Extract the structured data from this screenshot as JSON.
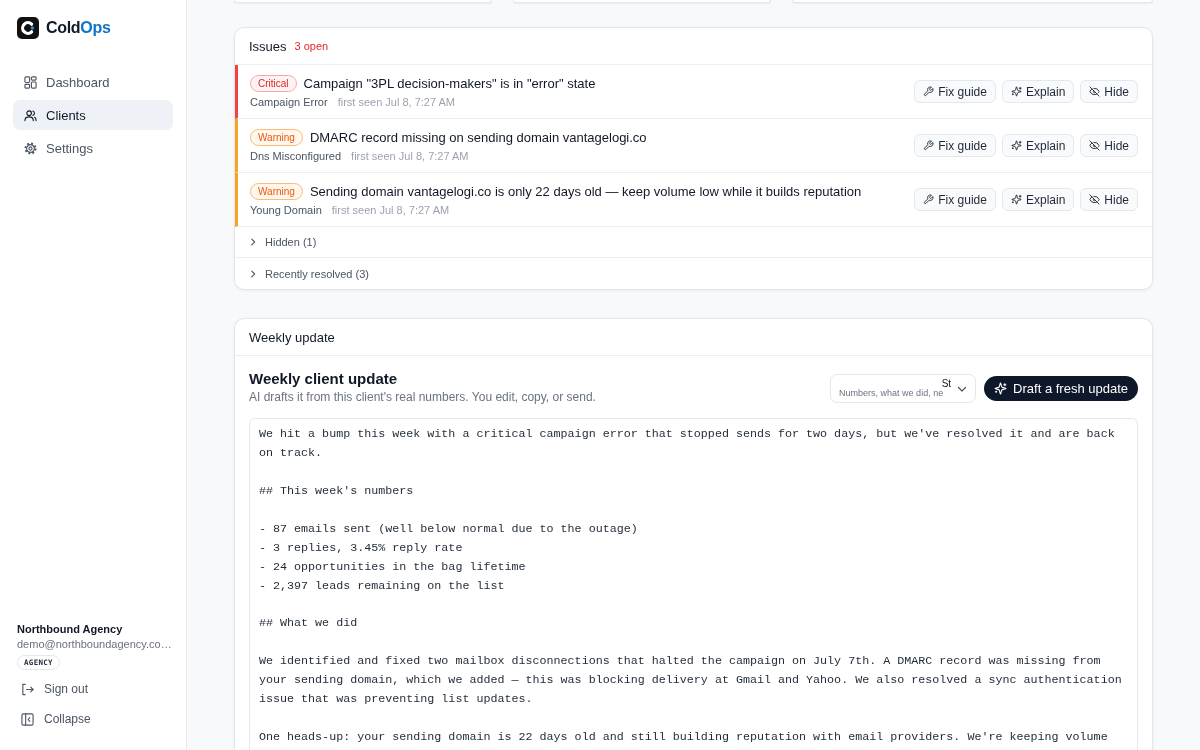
{
  "sidebar": {
    "brand": {
      "text": "Cold",
      "accent": "Ops"
    },
    "nav": [
      {
        "label": "Dashboard",
        "selected": false
      },
      {
        "label": "Clients",
        "selected": true
      },
      {
        "label": "Settings",
        "selected": false
      }
    ],
    "account": {
      "name": "Northbound Agency",
      "email": "demo@northboundagency.co…",
      "badge": "AGENCY"
    },
    "actions": [
      "Sign out",
      "Collapse"
    ]
  },
  "issues": {
    "title": "Issues",
    "count": "3 open",
    "items": [
      {
        "kind": "critical",
        "severity": "Critical",
        "title": "Campaign \"3PL decision-makers\" is in \"error\" state",
        "type": "Campaign Error",
        "seen": "first seen Jul 8, 7:27 AM",
        "actions": [
          "Fix guide",
          "Explain",
          "Hide"
        ]
      },
      {
        "kind": "warning",
        "severity": "Warning",
        "title": "DMARC record missing on sending domain vantagelogi.co",
        "type": "Dns Misconfigured",
        "seen": "first seen Jul 8, 7:27 AM",
        "actions": [
          "Fix guide",
          "Explain",
          "Hide"
        ]
      },
      {
        "kind": "warning",
        "severity": "Warning",
        "title": "Sending domain vantagelogi.co is only 22 days old — keep volume low while it builds reputation",
        "type": "Young Domain",
        "seen": "first seen Jul 8, 7:27 AM",
        "actions": [
          "Fix guide",
          "Explain",
          "Hide"
        ]
      }
    ],
    "groups": [
      {
        "label": "Hidden (1)",
        "expanded": false
      },
      {
        "label": "Recently resolved (3)",
        "expanded": false
      }
    ]
  },
  "weekly_update": {
    "title": "Weekly update",
    "heading": "Weekly client update",
    "subtitle": "AI drafts it from this client's real numbers. You edit, copy, or send.",
    "style_select": {
      "value": "St",
      "description": "Numbers, what we did, ne"
    },
    "draft_button": "Draft a fresh update",
    "body": "We hit a bump this week with a critical campaign error that stopped sends for two days, but we've resolved it and are back on track.\n\n## This week's numbers\n\n- 87 emails sent (well below normal due to the outage)\n- 3 replies, 3.45% reply rate\n- 24 opportunities in the bag lifetime\n- 2,397 leads remaining on the list\n\n## What we did\n\nWe identified and fixed two mailbox disconnections that halted the campaign on July 7th. A DMARC record was missing from your sending domain, which we added — this was blocking delivery at Gmail and Yahoo. We also resolved a sync authentication issue that was preventing list updates.\n\nOne heads-up: your sending domain is 22 days old and still building reputation with email providers. We're keeping volume"
  }
}
